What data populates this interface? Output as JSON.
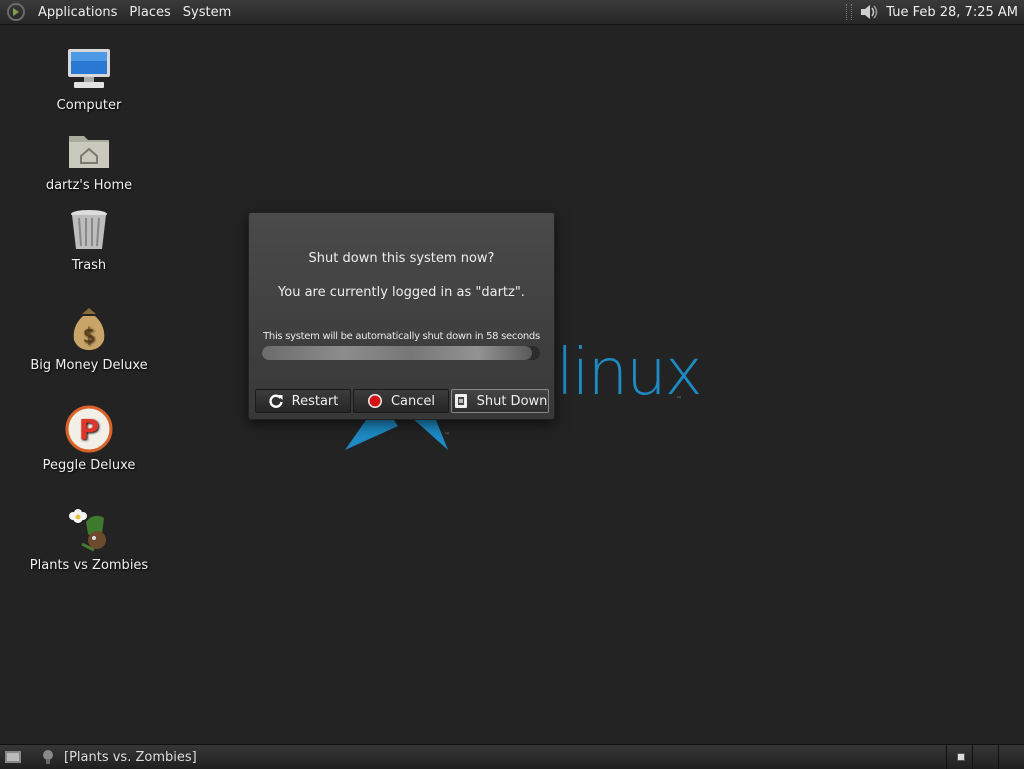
{
  "top_panel": {
    "menus": [
      "Applications",
      "Places",
      "System"
    ],
    "clock": "Tue Feb 28,  7:25 AM"
  },
  "desktop_icons": [
    {
      "label": "Computer",
      "icon": "computer-icon"
    },
    {
      "label": "dartz's Home",
      "icon": "home-folder-icon"
    },
    {
      "label": "Trash",
      "icon": "trash-icon"
    },
    {
      "label": "Big Money Deluxe",
      "icon": "money-bag-icon"
    },
    {
      "label": "Peggle Deluxe",
      "icon": "peggle-icon"
    },
    {
      "label": "Plants vs Zombies",
      "icon": "plants-vs-zombies-icon"
    }
  ],
  "wallpaper": {
    "text": "linux",
    "tm": "™",
    "accent": "#1e8ac4"
  },
  "dialog": {
    "title": "Shut down this system now?",
    "subtitle": "You are currently logged in as \"dartz\".",
    "countdown": "This system will be automatically shut down in 58 seconds",
    "progress_fraction": 0.97,
    "buttons": {
      "restart": "Restart",
      "cancel": "Cancel",
      "shutdown": "Shut Down"
    }
  },
  "bottom_panel": {
    "task_label": "[Plants vs. Zombies]",
    "workspaces": 3,
    "active_workspace": 1
  }
}
